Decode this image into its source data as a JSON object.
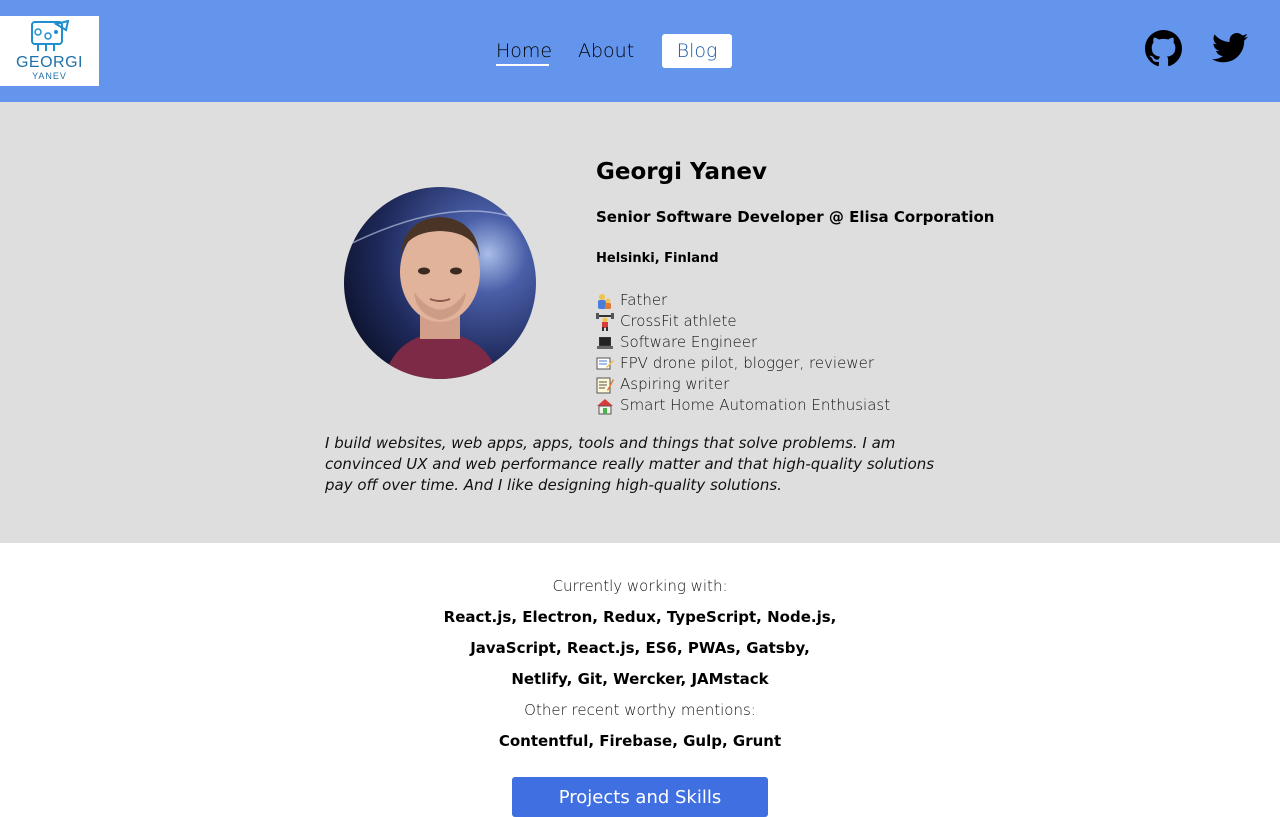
{
  "header": {
    "logo": {
      "name": "GEORGI",
      "subname": "YANEV"
    },
    "nav": [
      {
        "label": "Home",
        "active": true
      },
      {
        "label": "About",
        "active": false
      },
      {
        "label": "Blog",
        "active": false
      }
    ],
    "social": [
      {
        "icon": "github-icon"
      },
      {
        "icon": "twitter-icon"
      }
    ],
    "colors": {
      "bar": "#6495ed",
      "blog_text": "#1a56a8"
    }
  },
  "profile": {
    "name": "Georgi Yanev",
    "role": "Senior Software Developer @ Elisa Corporation",
    "location": "Helsinki, Finland",
    "traits": [
      {
        "icon": "father-emoji",
        "label": "Father"
      },
      {
        "icon": "weightlifter-emoji",
        "label": "CrossFit athlete"
      },
      {
        "icon": "laptop-emoji",
        "label": "Software Engineer"
      },
      {
        "icon": "drone-emoji",
        "label": "FPV drone pilot, blogger, reviewer"
      },
      {
        "icon": "memo-emoji",
        "label": "Aspiring writer"
      },
      {
        "icon": "house-emoji",
        "label": "Smart Home Automation Enthusiast"
      }
    ],
    "bio": "I build websites, web apps, apps, tools and things that solve problems. I am convinced UX and web performance really matter and that high-quality solutions pay off over time. And I like designing high-quality solutions."
  },
  "skills": {
    "current_label": "Currently working with:",
    "current_lines": [
      "React.js, Electron, Redux, TypeScript, Node.js,",
      "JavaScript, React.js, ES6, PWAs, Gatsby,",
      "Netlify, Git, Wercker, JAMstack"
    ],
    "other_label": "Other recent worthy mentions:",
    "other_line": "Contentful, Firebase, Gulp, Grunt",
    "button_label": "Projects and Skills",
    "button_color": "#3f6fe0"
  }
}
